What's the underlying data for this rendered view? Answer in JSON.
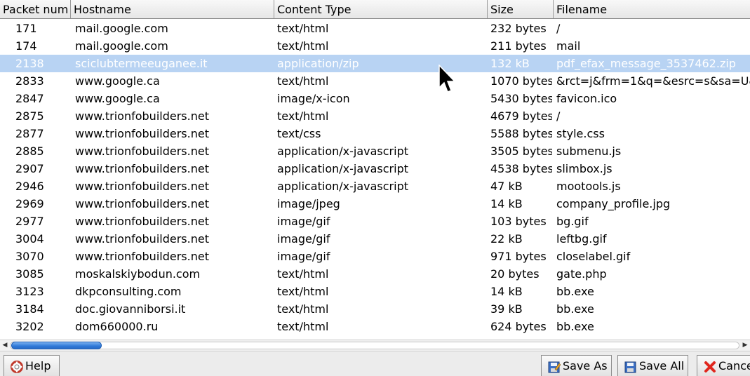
{
  "columns": [
    "Packet num",
    "Hostname",
    "Content Type",
    "Size",
    "Filename"
  ],
  "rows": [
    {
      "num": "171",
      "host": "mail.google.com",
      "type": "text/html",
      "size": "232 bytes",
      "file": "/"
    },
    {
      "num": "174",
      "host": "mail.google.com",
      "type": "text/html",
      "size": "211 bytes",
      "file": "mail"
    },
    {
      "num": "2138",
      "host": "sciclubtermeeuganee.it",
      "type": "application/zip",
      "size": "132 kB",
      "file": "pdf_efax_message_3537462.zip",
      "selected": true
    },
    {
      "num": "2833",
      "host": "www.google.ca",
      "type": "text/html",
      "size": "1070 bytes",
      "file": "&rct=j&frm=1&q=&esrc=s&sa=U&"
    },
    {
      "num": "2847",
      "host": "www.google.ca",
      "type": "image/x-icon",
      "size": "5430 bytes",
      "file": "favicon.ico"
    },
    {
      "num": "2875",
      "host": "www.trionfobuilders.net",
      "type": "text/html",
      "size": "4679 bytes",
      "file": "/"
    },
    {
      "num": "2877",
      "host": "www.trionfobuilders.net",
      "type": "text/css",
      "size": "5588 bytes",
      "file": "style.css"
    },
    {
      "num": "2885",
      "host": "www.trionfobuilders.net",
      "type": "application/x-javascript",
      "size": "3505 bytes",
      "file": "submenu.js"
    },
    {
      "num": "2907",
      "host": "www.trionfobuilders.net",
      "type": "application/x-javascript",
      "size": "4538 bytes",
      "file": "slimbox.js"
    },
    {
      "num": "2946",
      "host": "www.trionfobuilders.net",
      "type": "application/x-javascript",
      "size": "47 kB",
      "file": "mootools.js"
    },
    {
      "num": "2969",
      "host": "www.trionfobuilders.net",
      "type": "image/jpeg",
      "size": "14 kB",
      "file": "company_profile.jpg"
    },
    {
      "num": "2977",
      "host": "www.trionfobuilders.net",
      "type": "image/gif",
      "size": "103 bytes",
      "file": "bg.gif"
    },
    {
      "num": "3004",
      "host": "www.trionfobuilders.net",
      "type": "image/gif",
      "size": "22 kB",
      "file": "leftbg.gif"
    },
    {
      "num": "3070",
      "host": "www.trionfobuilders.net",
      "type": "image/gif",
      "size": "971 bytes",
      "file": "closelabel.gif"
    },
    {
      "num": "3085",
      "host": "moskalskiybodun.com",
      "type": "text/html",
      "size": "20 bytes",
      "file": "gate.php"
    },
    {
      "num": "3123",
      "host": "dkpconsulting.com",
      "type": "text/html",
      "size": "14 kB",
      "file": "bb.exe"
    },
    {
      "num": "3184",
      "host": "doc.giovanniborsi.it",
      "type": "text/html",
      "size": "39 kB",
      "file": "bb.exe"
    },
    {
      "num": "3202",
      "host": "dom660000.ru",
      "type": "text/html",
      "size": "624 bytes",
      "file": "bb.exe"
    }
  ],
  "buttons": {
    "help": {
      "label": "Help",
      "icon": "lifebuoy-icon"
    },
    "save_as": {
      "label": "Save As",
      "icon": "floppy-pencil-icon"
    },
    "save_all": {
      "label": "Save All",
      "icon": "floppy-icon"
    },
    "cancel": {
      "label": "Cancel",
      "icon": "red-x-icon"
    }
  },
  "colors": {
    "selected_row": "#b8d3f3",
    "scroll_thumb": "#2e78d8",
    "cancel_icon": "#e0271e"
  }
}
